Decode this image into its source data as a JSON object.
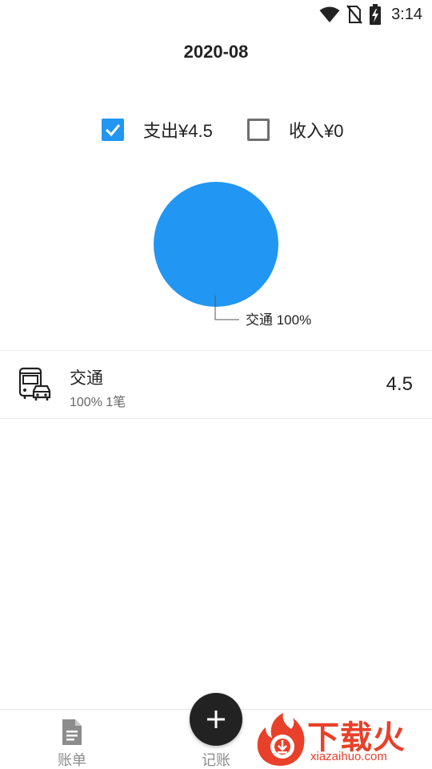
{
  "status_bar": {
    "time": "3:14",
    "icons": [
      "wifi-icon",
      "no-sim-icon",
      "battery-charging-icon"
    ]
  },
  "header": {
    "month": "2020-08"
  },
  "toggles": {
    "expense": {
      "label": "支出¥4.5",
      "checked": true
    },
    "income": {
      "label": "收入¥0",
      "checked": false
    }
  },
  "chart_data": {
    "type": "pie",
    "categories": [
      "交通"
    ],
    "values": [
      100
    ],
    "slice_labels": [
      "交通 100%"
    ],
    "colors": [
      "#2196F3"
    ]
  },
  "category_list": [
    {
      "icon": "bus-car-icon",
      "name": "交通",
      "meta": "100% 1笔",
      "amount": "4.5"
    }
  ],
  "bottom_nav": {
    "bills_label": "账单",
    "bills_icon": "document-icon",
    "record_label": "记账",
    "record_icon": "plus-icon"
  },
  "watermark": {
    "title": "下载火",
    "url": "xiazaihuo.com",
    "accent": "#e8402a"
  },
  "colors": {
    "accent": "#2196F3",
    "fab": "#222222"
  }
}
